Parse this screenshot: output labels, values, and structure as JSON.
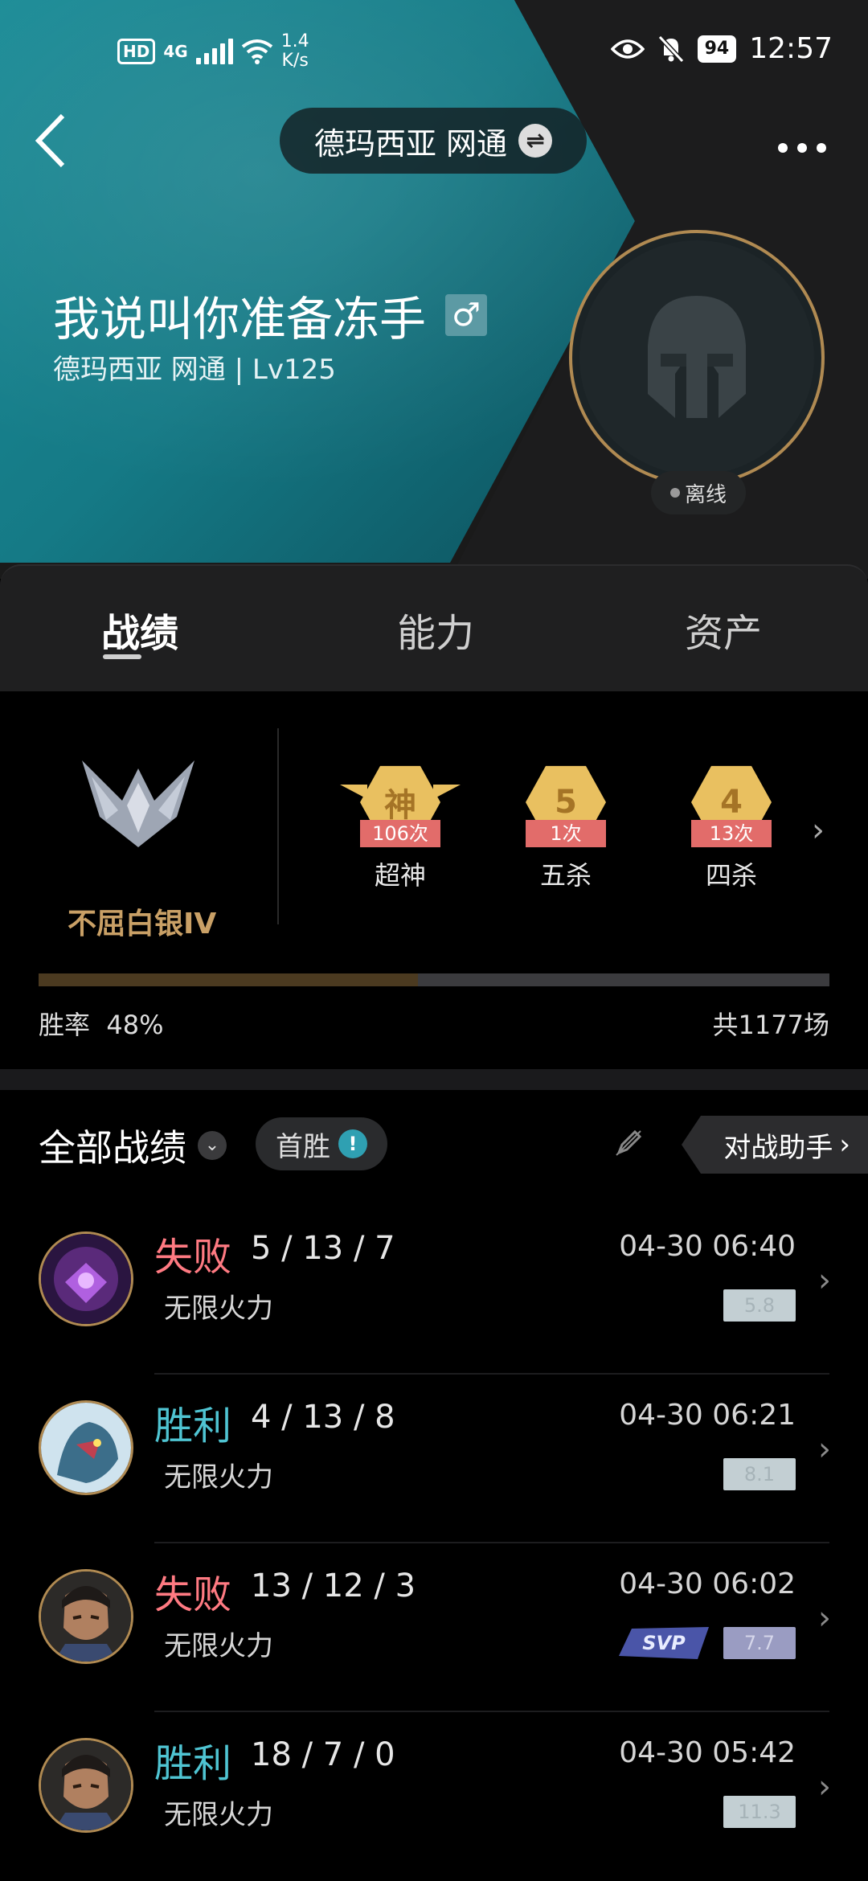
{
  "status_bar": {
    "hd": "HD",
    "network": "4G",
    "speed_value": "1.4",
    "speed_unit": "K/s",
    "battery": "94",
    "time": "12:57",
    "icons": [
      "eye-icon",
      "mute-bell-icon",
      "battery-icon",
      "wifi-icon",
      "signal-icon"
    ]
  },
  "header": {
    "back_icon": "back-chevron-icon",
    "server": "德玛西亚 网通",
    "swap_icon": "swap-icon",
    "more_icon": "more-dots-icon"
  },
  "profile": {
    "name": "我说叫你准备冻手",
    "gender_icon": "male-icon",
    "subtitle": "德玛西亚 网通 | Lv125",
    "status": "离线"
  },
  "tabs": [
    {
      "label": "战绩",
      "active": true
    },
    {
      "label": "能力",
      "active": false
    },
    {
      "label": "资产",
      "active": false
    }
  ],
  "summary": {
    "rank": "不屈白银IV",
    "badges": [
      {
        "symbol": "神",
        "count": "106次",
        "label": "超神"
      },
      {
        "symbol": "5",
        "count": "1次",
        "label": "五杀"
      },
      {
        "symbol": "4",
        "count": "13次",
        "label": "四杀"
      }
    ],
    "win_rate_label": "胜率",
    "win_rate_value": "48%",
    "win_rate_fraction": 0.48,
    "total_games": "共1177场"
  },
  "match_list": {
    "title": "全部战绩",
    "first_win": "首胜",
    "first_win_icon": "!",
    "assistant": "对战助手",
    "matches": [
      {
        "result": "失败",
        "outcome": "loss",
        "kda": "5 / 13 / 7",
        "mode": "无限火力",
        "time": "04-30 06:40",
        "score": "5.8",
        "svp": false,
        "champion_color": "#5a2a7a"
      },
      {
        "result": "胜利",
        "outcome": "win",
        "kda": "4 / 13 / 8",
        "mode": "无限火力",
        "time": "04-30 06:21",
        "score": "8.1",
        "svp": false,
        "champion_color": "#3c6e8a"
      },
      {
        "result": "失败",
        "outcome": "loss",
        "kda": "13 / 12 / 3",
        "mode": "无限火力",
        "time": "04-30 06:02",
        "score": "7.7",
        "svp": true,
        "svp_label": "SVP",
        "champion_color": "#5a4a3a"
      },
      {
        "result": "胜利",
        "outcome": "win",
        "kda": "18 / 7 / 0",
        "mode": "无限火力",
        "time": "04-30 05:42",
        "score": "11.3",
        "svp": false,
        "champion_color": "#5a4a3a"
      }
    ]
  }
}
